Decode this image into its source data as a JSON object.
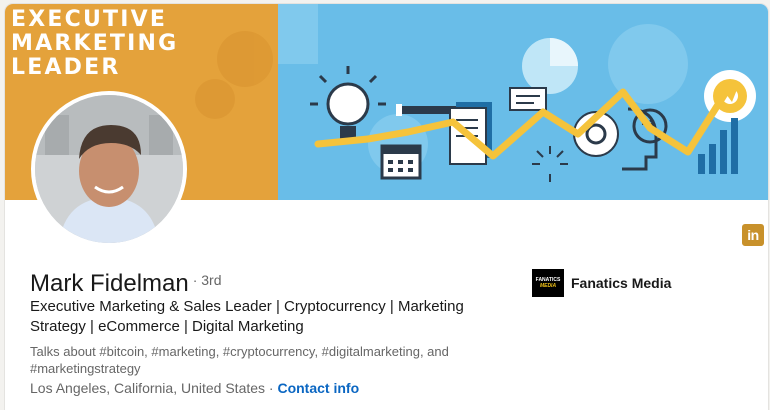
{
  "banner": {
    "title_line1": "EXECUTIVE",
    "title_line2": "MARKETING",
    "title_line3": "LEADER"
  },
  "profile": {
    "name": "Mark Fidelman",
    "degree": "· 3rd",
    "headline": "Executive Marketing & Sales Leader | Cryptocurrency | Marketing Strategy | eCommerce | Digital Marketing",
    "talks_about": "Talks about #bitcoin, #marketing, #cryptocurrency, #digitalmarketing, and #marketingstrategy",
    "location": "Los Angeles, California, United States ·",
    "contact_link": "Contact info"
  },
  "company": {
    "name": "Fanatics Media",
    "logo_line1": "FANATICS",
    "logo_line2": "MEDIA"
  },
  "linkedin_badge": "in",
  "colors": {
    "banner_left": "#e4a23b",
    "banner_right": "#69bde8",
    "accent_yellow": "#f5c33b",
    "link_blue": "#0a66c2",
    "badge": "#c8912b"
  }
}
